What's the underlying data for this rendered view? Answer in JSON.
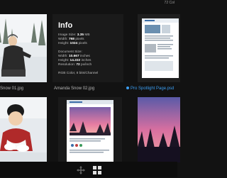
{
  "top_label": "72 Col",
  "thumbnails": [
    {
      "caption": "Snow 01.jpg"
    },
    {
      "caption": "Amanda Snow 02.jpg"
    },
    {
      "caption": "Pro Spotlight Page.psd",
      "selected": true
    },
    {
      "caption": ""
    },
    {
      "caption": ""
    },
    {
      "caption": ""
    }
  ],
  "info": {
    "title": "Info",
    "image_size_label": "Image Size:",
    "image_size_value": "3.35",
    "image_size_unit": "MB",
    "width_label": "Width:",
    "width_value": "768",
    "width_unit": "pixels",
    "height_label": "Height:",
    "height_value": "1024",
    "height_unit": "pixels",
    "doc_size_label": "Document Size:",
    "doc_width_label": "Width:",
    "doc_width_value": "10.667",
    "doc_width_unit": "inches",
    "doc_height_label": "Height:",
    "doc_height_value": "14.222",
    "doc_height_unit": "inches",
    "resolution_label": "Resolution:",
    "resolution_value": "72",
    "resolution_unit": "px/inch",
    "color_mode": "RGB Color, 8 bits/Channel"
  },
  "toolbar": {
    "move_icon": "move-icon",
    "grid_icon": "grid-view-icon"
  },
  "colors": {
    "background": "#121212",
    "selection": "#3b9df0"
  }
}
